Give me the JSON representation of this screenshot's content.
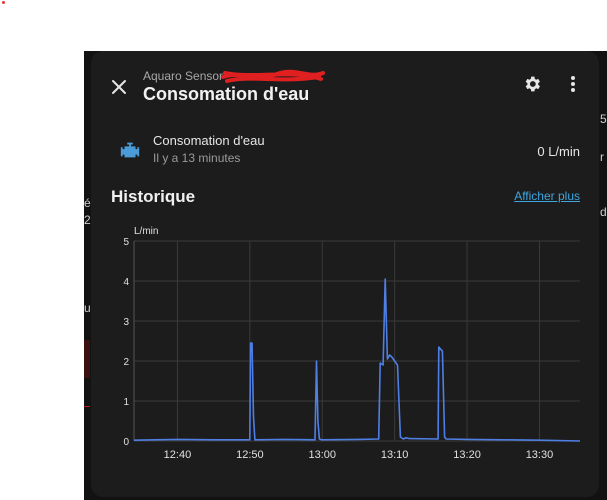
{
  "dialog": {
    "subtitle": "Aquaro Sensor",
    "title": "Consomation d'eau"
  },
  "entity": {
    "icon": "water-pump-icon",
    "name": "Consomation d'eau",
    "last_changed": "Il y a 13 minutes",
    "state": "0 L/min"
  },
  "history": {
    "heading": "Historique",
    "show_more": "Afficher plus"
  },
  "colors": {
    "line": "#4f7fe5",
    "link": "#3ea6e0",
    "dialog_bg": "#1c1c1c",
    "redaction": "#e02020"
  },
  "chart_data": {
    "type": "line",
    "title": "",
    "ylabel": "L/min",
    "ylim": [
      0,
      5
    ],
    "y_ticks": [
      "0",
      "1",
      "2",
      "3",
      "4",
      "5"
    ],
    "x_ticks": [
      "12:40",
      "12:50",
      "13:00",
      "13:10",
      "13:20",
      "13:30"
    ],
    "x_tick_minutes": [
      760,
      770,
      780,
      790,
      800,
      810
    ],
    "xlim_minutes": [
      754,
      815.6
    ],
    "grid": true,
    "series": [
      {
        "values_minutes": [
          754,
          760,
          765,
          770,
          770.1,
          770.3,
          770.5,
          770.7,
          775,
          779,
          779.2,
          779.4,
          779.6,
          779.9,
          785,
          787.8,
          788.0,
          788.4,
          788.7,
          789.0,
          789.3,
          789.6,
          790.0,
          790.4,
          790.8,
          791.2,
          791.6,
          792,
          796,
          796.1,
          796.3,
          796.6,
          796.9,
          797.1,
          800,
          805,
          810,
          815.6
        ],
        "values": [
          0.02,
          0.04,
          0.03,
          0.03,
          2.45,
          2.45,
          0.6,
          0.03,
          0.04,
          0.03,
          2.0,
          0.5,
          0.05,
          0.03,
          0.04,
          0.05,
          1.95,
          1.9,
          4.05,
          2.05,
          2.15,
          2.1,
          2.0,
          1.9,
          0.1,
          0.05,
          0.08,
          0.06,
          0.05,
          2.35,
          2.3,
          2.25,
          0.1,
          0.05,
          0.04,
          0.03,
          0.02,
          0.0
        ]
      }
    ]
  }
}
